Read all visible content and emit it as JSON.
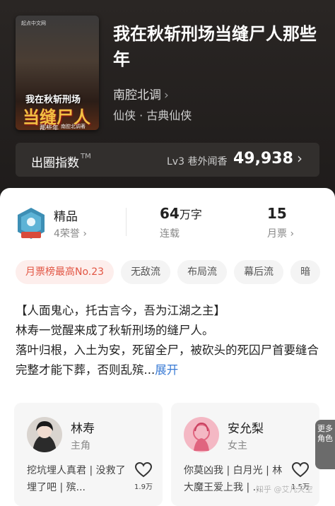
{
  "book": {
    "cover": {
      "publisher": "起点中文网",
      "title_top": "我在秋斩刑场",
      "title_big": "当缝尸人",
      "title_sub": "那些年",
      "author_small": "南腔北调著"
    },
    "title": "我在秋斩刑场当缝尸人那些年",
    "author": "南腔北调",
    "genre": "仙侠 · 古典仙侠"
  },
  "index_bar": {
    "label": "出圈指数",
    "tm": "TM",
    "rank": "Lv3 巷外闻香",
    "value": "49,938"
  },
  "stats": {
    "premium": "精品",
    "honors": "4荣誉",
    "words": "64",
    "words_unit": "万字",
    "status": "连载",
    "tickets": "15",
    "tickets_label": "月票"
  },
  "tags": [
    "月票榜最高No.23",
    "无敌流",
    "布局流",
    "幕后流",
    "暗"
  ],
  "synopsis": {
    "line1": "【人面鬼心，托古言今，吾为江湖之主】",
    "line2": "林寿一觉醒来成了秋斩刑场的缝尸人。",
    "line3": "落叶归根，入土为安，死留全尸，被砍头的死囚尸首要缝合完整才能下葬，否则乱殡...",
    "more": "展开"
  },
  "characters": [
    {
      "name": "林寿",
      "role": "主角",
      "desc": "挖坑埋人真君 | 没救了埋了吧 | 殡...",
      "likes": "1.9万"
    },
    {
      "name": "安允梨",
      "role": "女主",
      "desc": "你莫凶我 | 白月光 | 林大魔王爱上我 | ...",
      "likes": "1.5万"
    }
  ],
  "more_roles": "更多角色",
  "watermark": "知乎 @艾凡天空",
  "colors": {
    "accent": "#e25543",
    "link": "#3a7bd5"
  }
}
